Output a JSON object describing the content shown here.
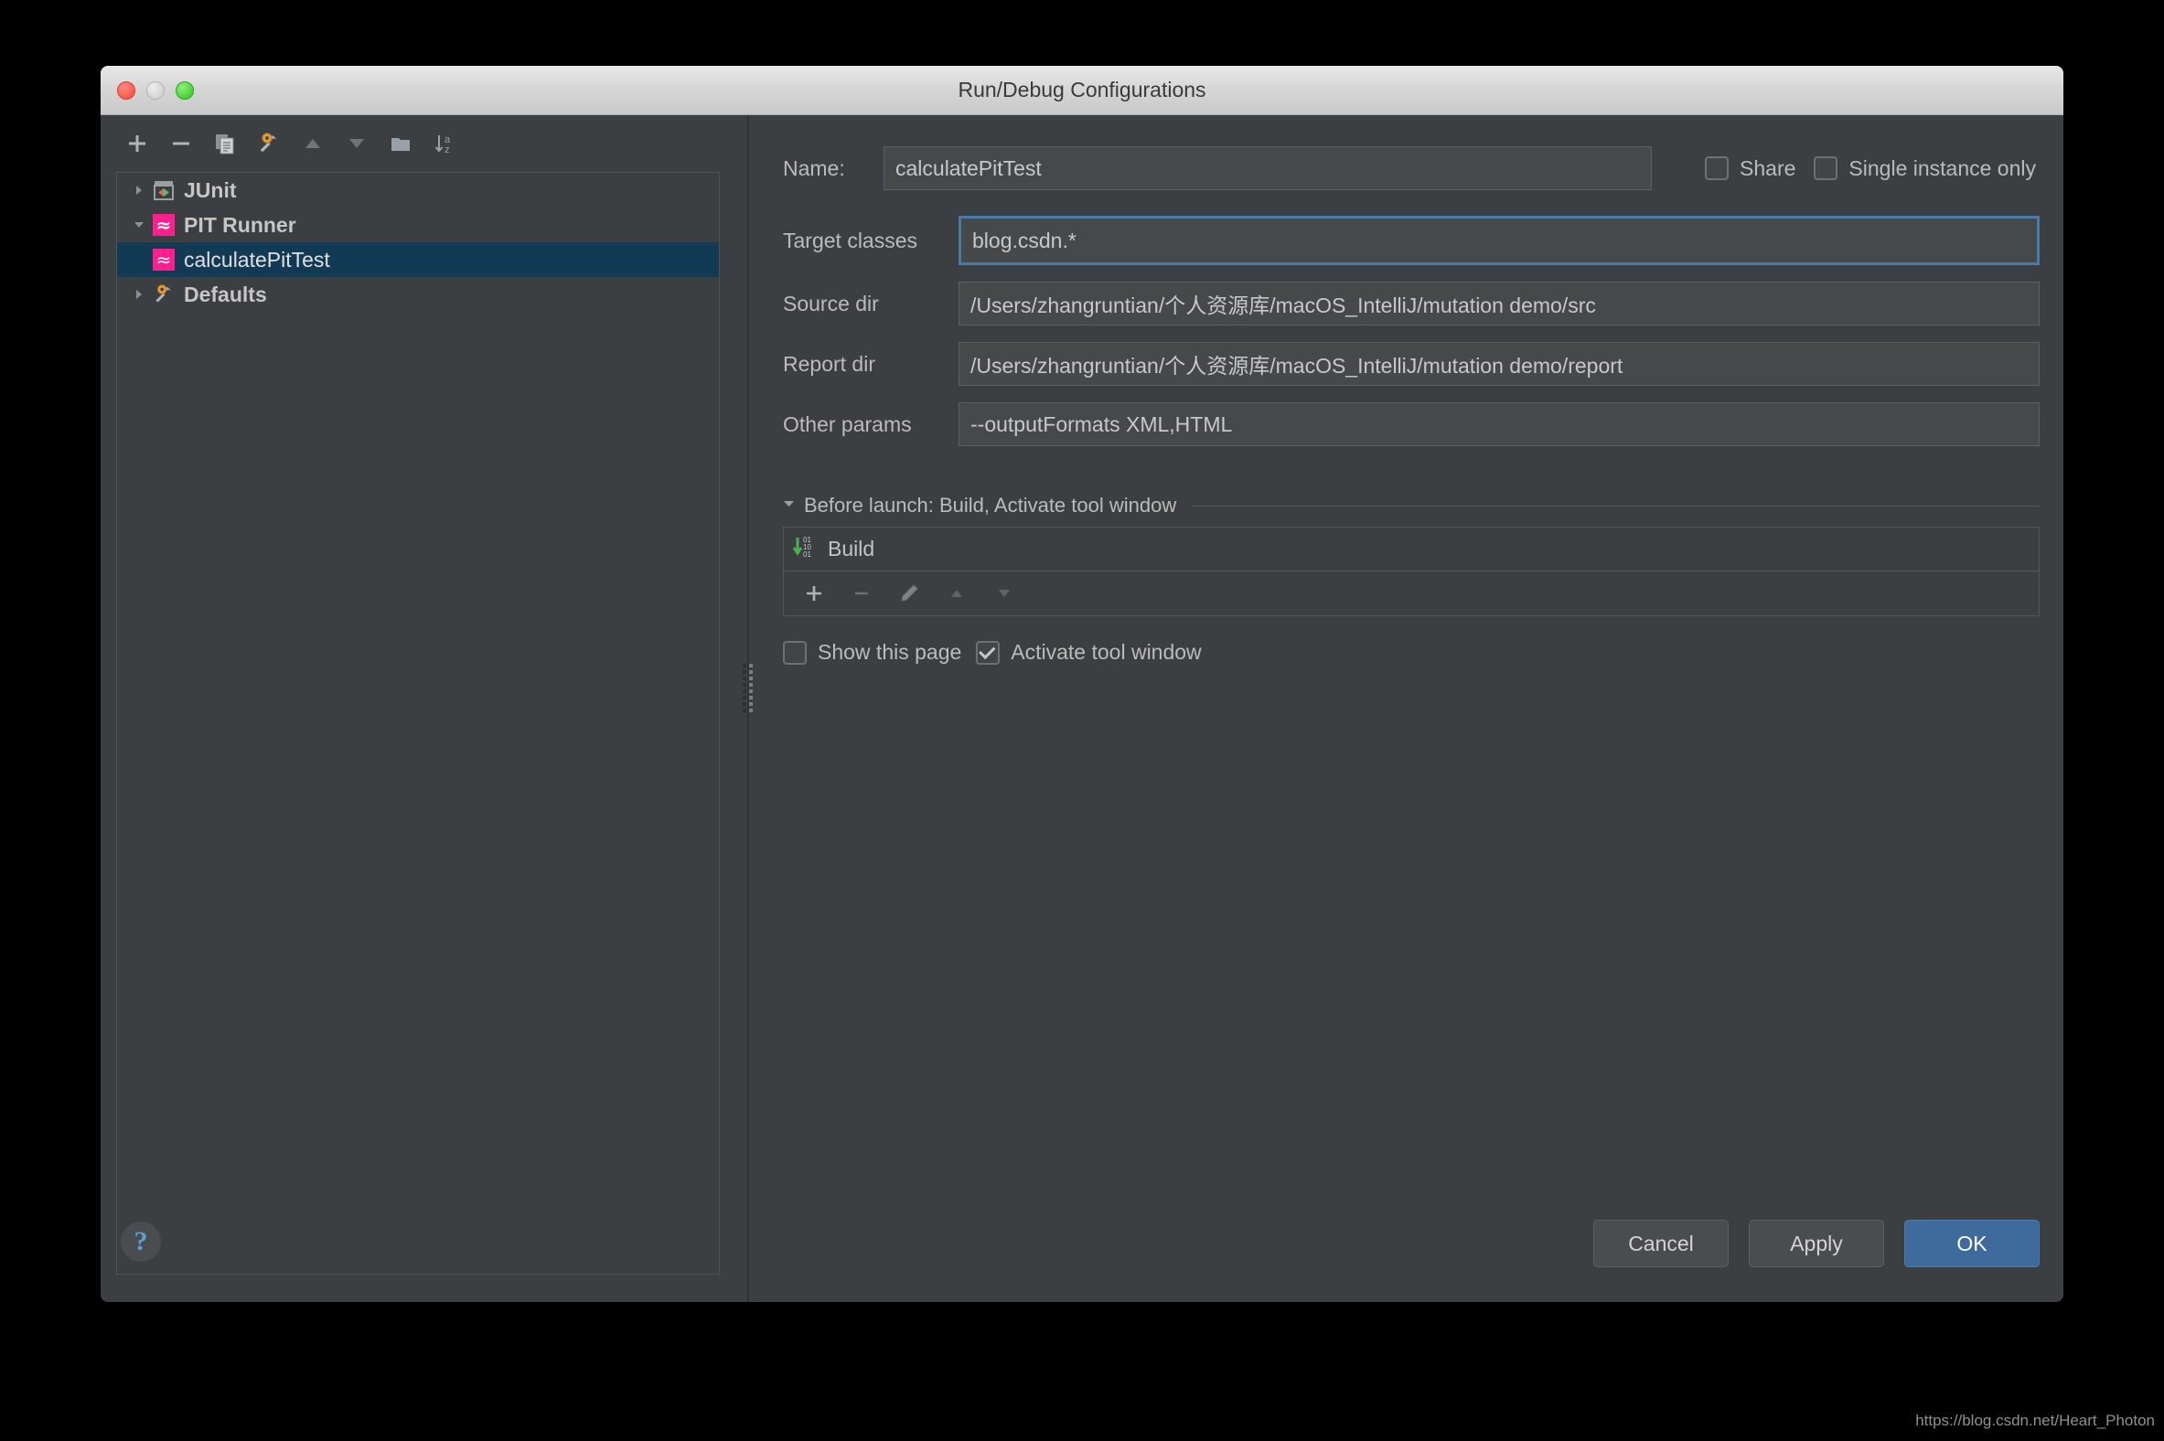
{
  "window": {
    "title": "Run/Debug Configurations",
    "traffic_lights": [
      "close",
      "minimize",
      "maximize"
    ]
  },
  "toolbar": {
    "buttons": [
      {
        "name": "add-configuration-button",
        "icon": "plus-icon",
        "tooltip": "Add New Configuration"
      },
      {
        "name": "remove-configuration-button",
        "icon": "minus-icon",
        "tooltip": "Remove Configuration"
      },
      {
        "name": "copy-configuration-button",
        "icon": "copy-icon",
        "tooltip": "Copy Configuration"
      },
      {
        "name": "edit-defaults-button",
        "icon": "wrench-icon",
        "tooltip": "Edit Defaults"
      },
      {
        "name": "move-up-button",
        "icon": "arrow-up-icon",
        "tooltip": "Move Up"
      },
      {
        "name": "move-down-button",
        "icon": "arrow-down-icon",
        "tooltip": "Move Down"
      },
      {
        "name": "new-folder-button",
        "icon": "folder-icon",
        "tooltip": "Create New Folder"
      },
      {
        "name": "sort-button",
        "icon": "sort-az-icon",
        "tooltip": "Sort Configurations"
      }
    ]
  },
  "tree": {
    "items": [
      {
        "label": "JUnit",
        "icon": "junit-icon",
        "expanded": false,
        "bold": true,
        "level": 0,
        "selected": false
      },
      {
        "label": "PIT Runner",
        "icon": "pit-icon",
        "expanded": true,
        "bold": true,
        "level": 0,
        "selected": false
      },
      {
        "label": "calculatePitTest",
        "icon": "pit-icon",
        "expanded": null,
        "bold": false,
        "level": 1,
        "selected": true
      },
      {
        "label": "Defaults",
        "icon": "wrench-icon",
        "expanded": false,
        "bold": true,
        "level": 0,
        "selected": false
      }
    ]
  },
  "form": {
    "name": {
      "label": "Name:",
      "value": "calculatePitTest"
    },
    "share": {
      "label": "Share",
      "checked": false
    },
    "single_instance": {
      "label": "Single instance only",
      "checked": false
    },
    "fields": [
      {
        "label": "Target classes",
        "value": "blog.csdn.*",
        "focused": true
      },
      {
        "label": "Source dir",
        "value": "/Users/zhangruntian/个人资源库/macOS_IntelliJ/mutation demo/src",
        "focused": false
      },
      {
        "label": "Report dir",
        "value": "/Users/zhangruntian/个人资源库/macOS_IntelliJ/mutation demo/report",
        "focused": false
      },
      {
        "label": "Other params",
        "value": "--outputFormats XML,HTML",
        "focused": false
      }
    ]
  },
  "before_launch": {
    "header": "Before launch: Build, Activate tool window",
    "tasks": [
      {
        "label": "Build",
        "icon": "build-icon"
      }
    ],
    "actions": [
      {
        "name": "add-task-button",
        "icon": "plus-icon"
      },
      {
        "name": "remove-task-button",
        "icon": "minus-icon"
      },
      {
        "name": "edit-task-button",
        "icon": "pencil-icon"
      },
      {
        "name": "task-move-up-button",
        "icon": "arrow-up-icon"
      },
      {
        "name": "task-move-down-button",
        "icon": "arrow-down-icon"
      }
    ],
    "show_this_page": {
      "label": "Show this page",
      "checked": false
    },
    "activate_tool_window": {
      "label": "Activate tool window",
      "checked": true
    }
  },
  "bottom": {
    "help": "?",
    "cancel": "Cancel",
    "apply": "Apply",
    "ok": "OK"
  },
  "watermark": "https://blog.csdn.net/Heart_Photon",
  "colors": {
    "background": "#3c3f41",
    "titlebar": "#d4d4d4",
    "selection": "#123a54",
    "focus_border": "#4a7ba7",
    "primary_button": "#3f6a9c",
    "pit_icon": "#ff1f8f",
    "help_icon": "#5b9ed6",
    "build_arrow": "#4caf50"
  }
}
